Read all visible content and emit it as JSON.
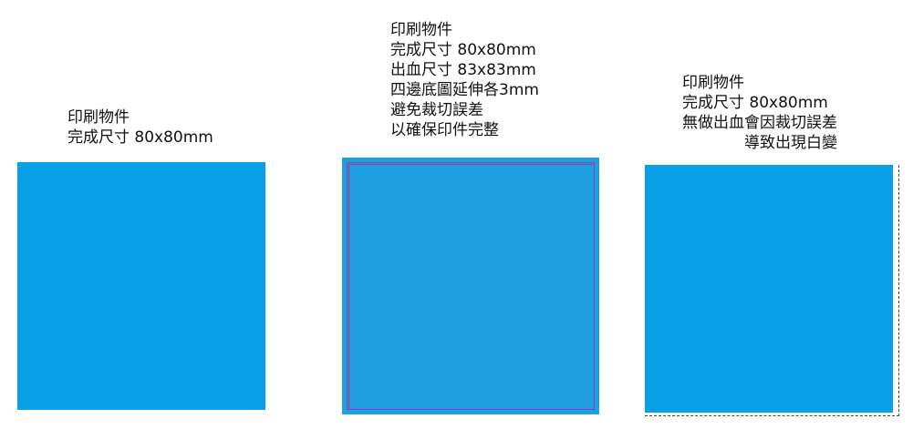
{
  "panels": [
    {
      "caption": [
        "印刷物件",
        "完成尺寸 80x80mm"
      ]
    },
    {
      "caption": [
        "印刷物件",
        "完成尺寸 80x80mm",
        "出血尺寸 83x83mm",
        "四邊底圖延伸各3mm",
        "避免裁切誤差",
        "以確保印件完整"
      ]
    },
    {
      "caption": [
        "印刷物件",
        "完成尺寸 80x80mm",
        "無做出血會因裁切誤差",
        "導致出現白變"
      ]
    }
  ],
  "colors": {
    "fill": "#0aa0e8",
    "bleed_fill": "#1d9fe2",
    "trim_line": "#b03a78",
    "dashed_line": "#444444"
  }
}
